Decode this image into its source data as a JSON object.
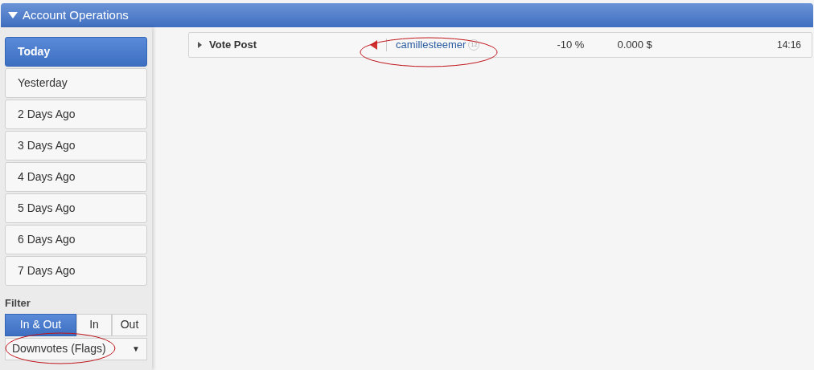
{
  "header": {
    "title": "Account Operations"
  },
  "days": [
    {
      "label": "Today",
      "selected": true
    },
    {
      "label": "Yesterday",
      "selected": false
    },
    {
      "label": "2 Days Ago",
      "selected": false
    },
    {
      "label": "3 Days Ago",
      "selected": false
    },
    {
      "label": "4 Days Ago",
      "selected": false
    },
    {
      "label": "5 Days Ago",
      "selected": false
    },
    {
      "label": "6 Days Ago",
      "selected": false
    },
    {
      "label": "7 Days Ago",
      "selected": false
    }
  ],
  "filter": {
    "label": "Filter",
    "options": [
      {
        "label": "In & Out",
        "selected": true
      },
      {
        "label": "In",
        "selected": false
      },
      {
        "label": "Out",
        "selected": false
      }
    ],
    "dropdown": {
      "value": "Downvotes (Flags)",
      "caret": "▼"
    }
  },
  "operations": [
    {
      "type": "Vote Post",
      "account": "camillesteemer",
      "reputation": "12",
      "weight": "-10 %",
      "value": "0.000 $",
      "time": "14:16",
      "downvote": true
    }
  ]
}
